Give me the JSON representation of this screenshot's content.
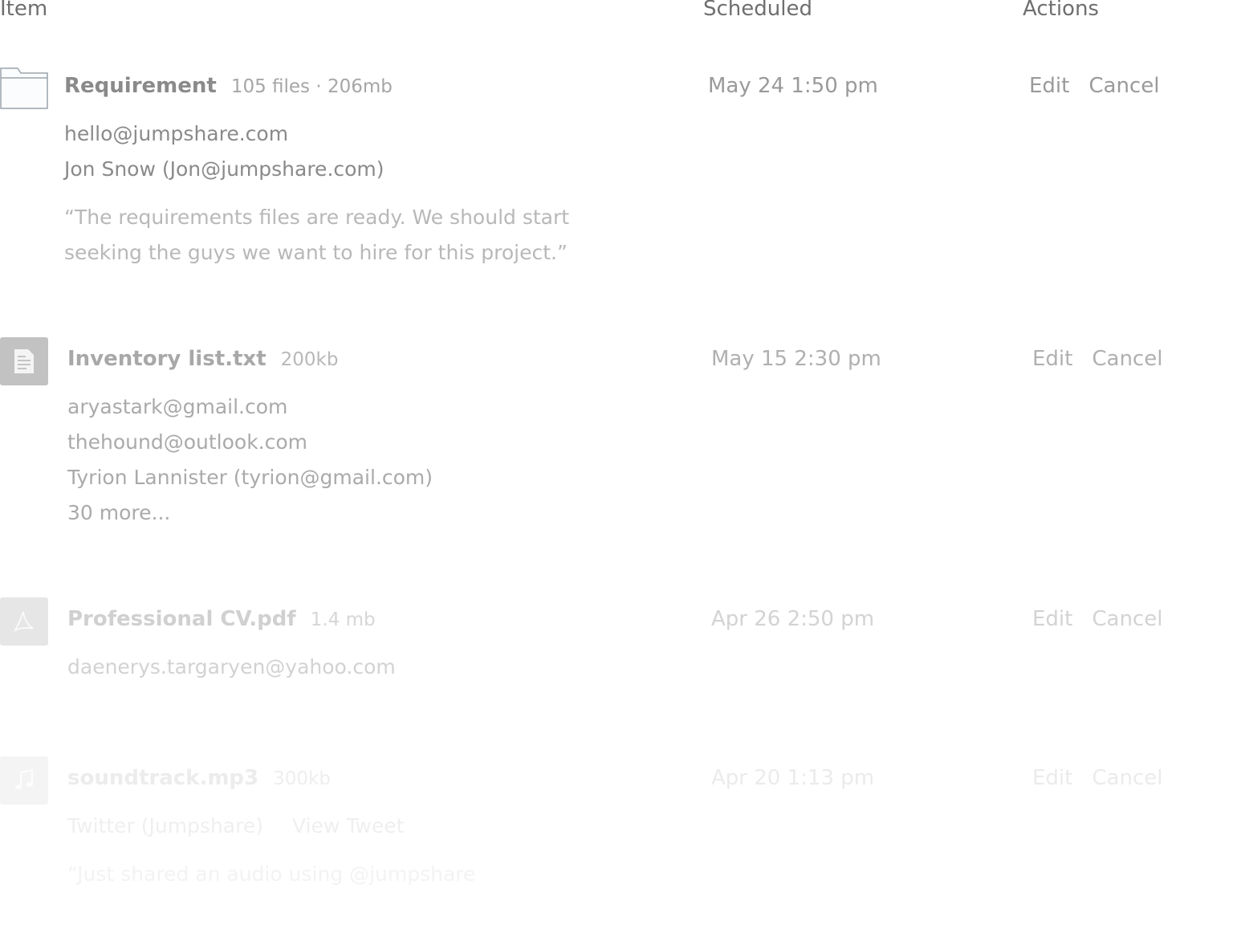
{
  "header": {
    "item_label": "Item",
    "scheduled_label": "Scheduled",
    "actions_label": "Actions"
  },
  "rows": [
    {
      "icon": "folder-icon",
      "title": "Requirement",
      "meta": "105 files · 206mb",
      "scheduled": "May 24  1:50 pm",
      "edit_label": "Edit",
      "cancel_label": "Cancel",
      "recipients": [
        "hello@jumpshare.com",
        "Jon Snow (Jon@jumpshare.com)"
      ],
      "message_lines": [
        "“The requirements files are ready. We should start",
        "seeking the guys we want to hire for this project.”"
      ]
    },
    {
      "icon": "text-file-icon",
      "title": "Inventory list.txt",
      "meta": "200kb",
      "scheduled": "May 15  2:30 pm",
      "edit_label": "Edit",
      "cancel_label": "Cancel",
      "recipients": [
        "aryastark@gmail.com",
        "thehound@outlook.com",
        "Tyrion Lannister (tyrion@gmail.com)",
        "30 more..."
      ]
    },
    {
      "icon": "pdf-file-icon",
      "title": "Professional CV.pdf",
      "meta": "1.4 mb",
      "scheduled": "Apr 26  2:50 pm",
      "edit_label": "Edit",
      "cancel_label": "Cancel",
      "recipients": [
        "daenerys.targaryen@yahoo.com"
      ]
    },
    {
      "icon": "music-file-icon",
      "title": "soundtrack.mp3",
      "meta": "300kb",
      "scheduled": "Apr 20  1:13 pm",
      "edit_label": "Edit",
      "cancel_label": "Cancel",
      "destination": "Twitter (Jumpshare)",
      "view_tweet_label": "View Tweet",
      "message_line": "“Just shared an audio using @jumpshare"
    }
  ]
}
